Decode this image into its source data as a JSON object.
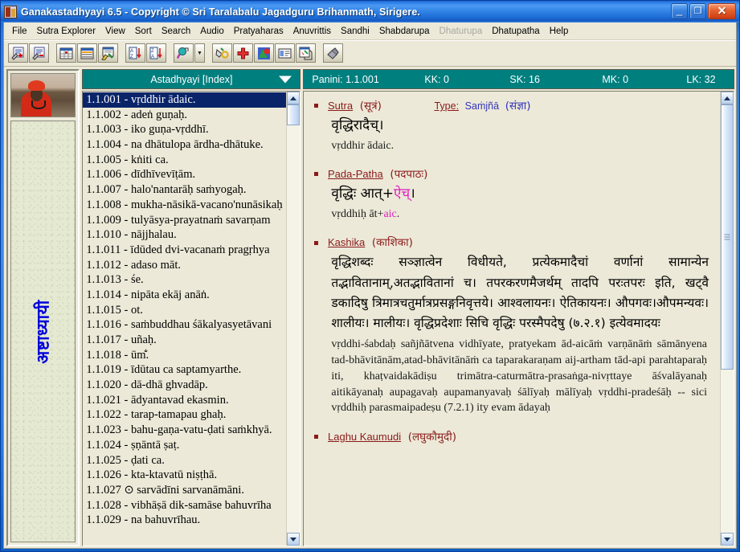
{
  "window": {
    "title": "Ganakastadhyayi 6.5 - Copyright © Sri Taralabalu Jagadguru Brihanmath, Sirigere.",
    "minimize_label": "_",
    "maximize_label": "❐",
    "close_label": "✕",
    "accent_teal": "#007f7f",
    "accent_titlebar": "#2e80e4",
    "selection_blue": "#0a246a",
    "page_background": "#ece9d8",
    "link_red": "#8b1a1a",
    "highlight_magenta": "#e020c0"
  },
  "menu": {
    "items": [
      {
        "label": "File",
        "disabled": false
      },
      {
        "label": "Sutra Explorer",
        "disabled": false
      },
      {
        "label": "View",
        "disabled": false
      },
      {
        "label": "Sort",
        "disabled": false
      },
      {
        "label": "Search",
        "disabled": false
      },
      {
        "label": "Audio",
        "disabled": false
      },
      {
        "label": "Pratyaharas",
        "disabled": false
      },
      {
        "label": "Anuvrittis",
        "disabled": false
      },
      {
        "label": "Sandhi",
        "disabled": false
      },
      {
        "label": "Shabdarupa",
        "disabled": false
      },
      {
        "label": "Dhaturupa",
        "disabled": true
      },
      {
        "label": "Dhatupatha",
        "disabled": false
      },
      {
        "label": "Help",
        "disabled": false
      }
    ]
  },
  "toolbar": {
    "buttons": [
      {
        "name": "zoom-in-text-icon"
      },
      {
        "name": "zoom-out-text-icon"
      },
      {
        "name": "grid-view-icon"
      },
      {
        "name": "list-view-icon"
      },
      {
        "name": "report-tools-icon"
      },
      {
        "sep": true
      },
      {
        "name": "sort-ascending-icon"
      },
      {
        "name": "sort-descending-icon"
      },
      {
        "sep": true
      },
      {
        "name": "search-icon"
      },
      {
        "name": "search-dropdown-arrow",
        "dropdown": true
      },
      {
        "sep": true
      },
      {
        "name": "pratyahara-tool-icon"
      },
      {
        "name": "add-red-cross-icon"
      },
      {
        "name": "shapes-color-icon"
      },
      {
        "name": "details-pane-icon"
      },
      {
        "name": "export-window-icon"
      },
      {
        "sep": true
      },
      {
        "name": "audio-speaker-icon"
      }
    ]
  },
  "sidebar": {
    "photo_alt": "guru-portrait",
    "banner_text": "अष्टाध्यायी"
  },
  "index_panel": {
    "header_label": "Astadhyayi [Index]",
    "dropdown_icon": "chevron-down-icon",
    "items": [
      "1.1.001 - vṛddhir ādaic.",
      "1.1.002 - adeṅ guṇaḥ.",
      "1.1.003 - iko guṇa-vṛddhī.",
      "1.1.004 - na dhātulopa ārdha-dhātuke.",
      "1.1.005 - kṅiti ca.",
      "1.1.006 - dīdhīvevīṭām.",
      "1.1.007 - halo'nantarāḥ saṁyogaḥ.",
      "1.1.008 - mukha-nāsikā-vacano'nunāsikaḥ",
      "1.1.009 - tulyāsya-prayatnaṁ savarṇam",
      "1.1.010 - nājjhalau.",
      "1.1.011 - īdūded dvi-vacanaṁ pragṛhya",
      "1.1.012 - adaso māt.",
      "1.1.013 - śe.",
      "1.1.014 - nipāta ekāj anāṅ.",
      "1.1.015 - ot.",
      "1.1.016 - saṁbuddhau śākalyasyetāvani",
      "1.1.017 - uñaḥ.",
      "1.1.018 - ūm̐.",
      "1.1.019 - īdūtau ca saptamyarthe.",
      "1.1.020 - dā-dhā ghvadāp.",
      "1.1.021 - ādyantavad ekasmin.",
      "1.1.022 - tarap-tamapau ghaḥ.",
      "1.1.023 - bahu-gaṇa-vatu-ḍati saṁkhyā.",
      "1.1.024 - ṣṇāntā ṣaṭ.",
      "1.1.025 - ḍati ca.",
      "1.1.026 - kta-ktavatū niṣṭhā.",
      "1.1.027 ⊙ sarvādīni sarvanāmāni.",
      "1.1.028 - vibhāṣā dik-samāse bahuvrīha",
      "1.1.029 - na bahuvrīhau."
    ],
    "selected_index": 0
  },
  "detail_panel": {
    "header": {
      "panini": "Panini: 1.1.001",
      "kk": "KK: 0",
      "sk": "SK: 16",
      "mk": "MK: 0",
      "lk": "LK: 32"
    },
    "sections": [
      {
        "label": "Sutra",
        "devanagari_label": "(सूत्रं)",
        "type_label": "Type:",
        "type_value": "Saṁjñā",
        "type_devanagari": "(संज्ञा)",
        "devanagari_text": "वृद्धिरादैच्।",
        "roman_text": "vṛddhir ādaic."
      },
      {
        "label": "Pada-Patha",
        "devanagari_label": "(पदपाठः)",
        "devanagari_text": "वृद्धिः आत्+",
        "devanagari_highlight": "ऐच्",
        "devanagari_tail": "।",
        "roman_text": "vṛddhiḥ āt+",
        "roman_highlight": "aic",
        "roman_tail": "."
      },
      {
        "label": "Kashika",
        "devanagari_label": "(काशिका)",
        "devanagari_body": "वृद्धिशब्दः सञ्ज्ञात्वेन विधीयते, प्रत्येकमादैचां वर्णानां सामान्येन तद्भावितानाम्‚अतद्भावितानां च। तपरकरणमैजर्थम् तादपि परःतपरः इति, खट्वै डकादिषु त्रिमात्रचतुर्मात्रप्रसङ्गनिवृत्तये। आश्वलायनः। ऐतिकायनः। औपगवः।औपमन्यवः। शालीयः। मालीयः। वृद्धिप्रदेशाः सिचि वृद्धिः परस्मैपदेषु (७.२.१) इत्येवमादयः",
        "roman_body": "vṛddhi-śabdaḥ sañjñātvena vidhīyate, pratyekam ād-aicāṁ varṇānāṁ sāmānyena tad-bhāvitānām,atad-bhāvitānāṁ ca taparakaraṇam aij-artham tād-api parahtaparaḥ iti, khaṭvaidakādiṣu trimātra-caturmātra-prasaṅga-nivṛttaye āśvalāyanaḥ aitikāyanaḥ aupagavaḥ aupamanyavaḥ śālīyaḥ mālīyaḥ vṛddhi-pradeśāḥ -- sici vṛddhiḥ parasmaipadeṣu (7.2.1) ity evam ādayaḥ"
      },
      {
        "label": "Laghu Kaumudi",
        "devanagari_label": "(लघुकौमुदी)"
      }
    ]
  }
}
